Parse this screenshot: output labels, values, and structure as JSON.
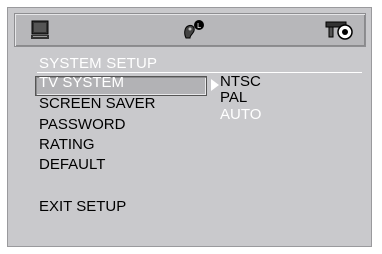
{
  "title": "SYSTEM SETUP",
  "menu": [
    {
      "label": "TV SYSTEM",
      "selected": true
    },
    {
      "label": "SCREEN SAVER",
      "selected": false
    },
    {
      "label": "PASSWORD",
      "selected": false
    },
    {
      "label": "RATING",
      "selected": false
    },
    {
      "label": "DEFAULT",
      "selected": false
    },
    {
      "label": "EXIT SETUP",
      "selected": false
    }
  ],
  "options": [
    {
      "label": "NTSC",
      "active": false
    },
    {
      "label": "PAL",
      "active": false
    },
    {
      "label": "AUTO",
      "active": true
    }
  ],
  "toolbar": {
    "icons": [
      "monitor-icon",
      "person-audio-icon",
      "speaker-settings-icon"
    ]
  },
  "colors": {
    "background": "#c9c9cc",
    "toolbar": "#b7b7ba",
    "highlight_text": "#ffffff",
    "normal_text": "#000000"
  }
}
